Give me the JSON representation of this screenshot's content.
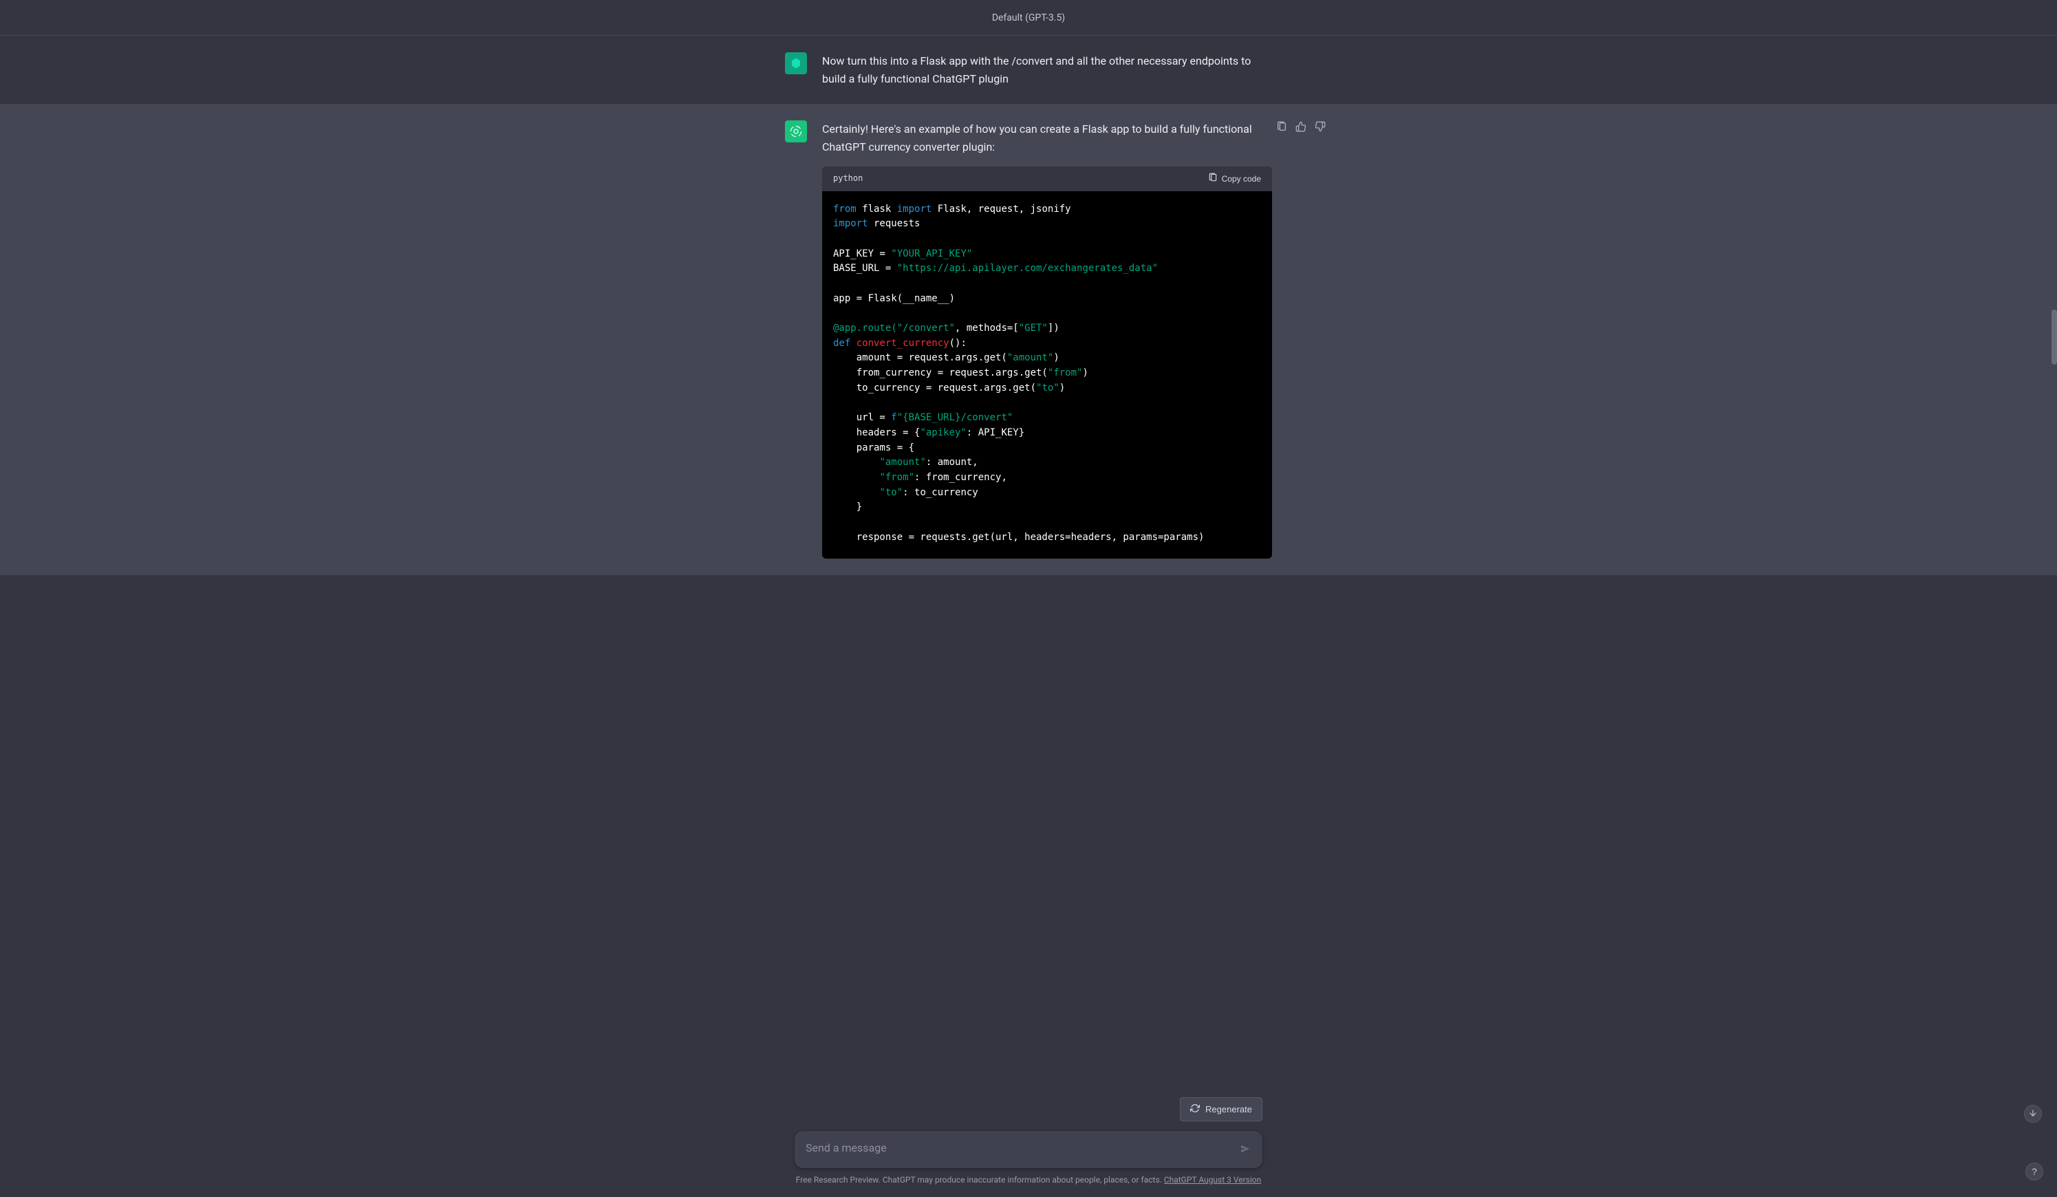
{
  "header": {
    "title": "Default (GPT-3.5)"
  },
  "messages": {
    "user1": {
      "text": "Now turn this into a Flask app with the /convert and all the other necessary endpoints to build a fully functional ChatGPT plugin"
    },
    "assistant1": {
      "intro": "Certainly! Here's an example of how you can create a Flask app to build a fully functional ChatGPT currency converter plugin:",
      "code_lang": "python",
      "copy_label": "Copy code",
      "code_tokens": {
        "kw_from": "from",
        "flask_mod": " flask ",
        "kw_import1": "import",
        "flask_names": " Flask, request, jsonify",
        "kw_import2": "import",
        "requests_mod": " requests",
        "api_key_lhs": "API_KEY = ",
        "api_key_str": "\"YOUR_API_KEY\"",
        "base_url_lhs": "BASE_URL = ",
        "base_url_str": "\"https://api.apilayer.com/exchangerates_data\"",
        "app_assign": "app = Flask(__name__)",
        "route_decor_at": "@app.route(",
        "route_path_str": "\"/convert\"",
        "route_mid": ", methods=[",
        "route_get_str": "\"GET\"",
        "route_end": "])",
        "kw_def": "def",
        "func_name": " convert_currency",
        "func_parens": "():",
        "amount_line_pre": "    amount = request.args.get(",
        "amount_str": "\"amount\"",
        "amount_line_post": ")",
        "from_line_pre": "    from_currency = request.args.get(",
        "from_str": "\"from\"",
        "from_line_post": ")",
        "to_line_pre": "    to_currency = request.args.get(",
        "to_str": "\"to\"",
        "to_line_post": ")",
        "url_pre": "    url = ",
        "url_f": "f",
        "url_str": "\"{BASE_URL}/convert\"",
        "headers_pre": "    headers = {",
        "headers_key": "\"apikey\"",
        "headers_post": ": API_KEY}",
        "params_open": "    params = {",
        "p_amount_key": "\"amount\"",
        "p_amount_post": ": amount,",
        "p_from_key": "\"from\"",
        "p_from_post": ": from_currency,",
        "p_to_key": "\"to\"",
        "p_to_post": ": to_currency",
        "params_close": "    }",
        "response_line": "    response = requests.get(url, headers=headers, params=params)"
      }
    }
  },
  "regenerate_label": "Regenerate",
  "input": {
    "placeholder": "Send a message"
  },
  "disclaimer": {
    "prefix": "Free Research Preview. ChatGPT may produce inaccurate information about people, places, or facts. ",
    "link": "ChatGPT August 3 Version"
  },
  "help_label": "?"
}
